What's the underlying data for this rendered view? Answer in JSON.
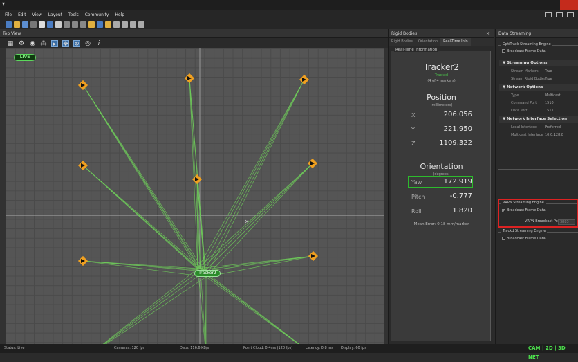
{
  "menu": [
    "File",
    "Edit",
    "View",
    "Layout",
    "Tools",
    "Community",
    "Help"
  ],
  "topview": {
    "title": "Top View",
    "live_label": "LIVE",
    "toolbar_icons": [
      "grid-icon",
      "camera-settings-icon",
      "camera-icon",
      "skeleton-icon",
      "select-mode-icon",
      "translate-mode-icon",
      "rotate-mode-icon",
      "visibility-icon",
      "info-icon"
    ],
    "tracker_label": "Tracker2"
  },
  "rigid_bodies": {
    "title": "Rigid Bodies",
    "close": "×",
    "tabs": [
      "Rigid Bodies",
      "Orientation",
      "Real-Time Info"
    ],
    "group_title": "Real-Time Information",
    "body_name": "Tracker2",
    "tracked_status": "Tracked",
    "markers": "(4 of 4 markers)",
    "position_title": "Position",
    "position_units": "(millimeters)",
    "position": [
      {
        "axis": "X",
        "value": "206.056"
      },
      {
        "axis": "Y",
        "value": "221.950"
      },
      {
        "axis": "Z",
        "value": "1109.322"
      }
    ],
    "orientation_title": "Orientation",
    "orientation_units": "(degrees)",
    "orientation": [
      {
        "axis": "Yaw",
        "value": "172.919"
      },
      {
        "axis": "Pitch",
        "value": "-0.777"
      },
      {
        "axis": "Roll",
        "value": "1.820"
      }
    ],
    "mean_error": "Mean Error: 0.18 mm/marker"
  },
  "data_streaming": {
    "title": "Data Streaming",
    "natnet": {
      "group": "OptiTrack Streaming Engine",
      "broadcast": "Broadcast Frame Data",
      "streaming_options": "Streaming Options",
      "stream_markers_k": "Stream Markers",
      "stream_markers_v": "True",
      "stream_rb_k": "Stream Rigid Bodies",
      "stream_rb_v": "True",
      "network_options": "Network Options",
      "type_k": "Type",
      "type_v": "Multicast",
      "cmd_k": "Command Port",
      "cmd_v": "1510",
      "data_k": "Data Port",
      "data_v": "1511",
      "nic_section": "Network Interface Selection",
      "local_k": "Local Interface",
      "local_v": "Preferred",
      "mc_k": "Multicast Interface",
      "mc_v": "10.0.128.8"
    },
    "vrpn": {
      "group": "VRPN Streaming Engine",
      "broadcast": "Broadcast Frame Data",
      "port_label": "VRPN Broadcast Port",
      "port_value": "3883"
    },
    "trackd": {
      "group": "Trackd Streaming Engine",
      "broadcast": "Broadcast Frame Data"
    }
  },
  "status": {
    "status": "Status: Live",
    "cameras": "Cameras: 120 fps",
    "data": "Data: 116.6 KB/s",
    "point_cloud": "Point Cloud: 0.4ms (120 fps)",
    "latency": "Latency: 0.8 ms",
    "display": "Display: 60 fps",
    "modes": "CAM | 2D | 3D | NET"
  },
  "colors": {
    "accent_green": "#2dbb2d",
    "highlight_red": "#d22222",
    "live_green": "#5bd85b",
    "camera_orange": "#f0a020"
  }
}
